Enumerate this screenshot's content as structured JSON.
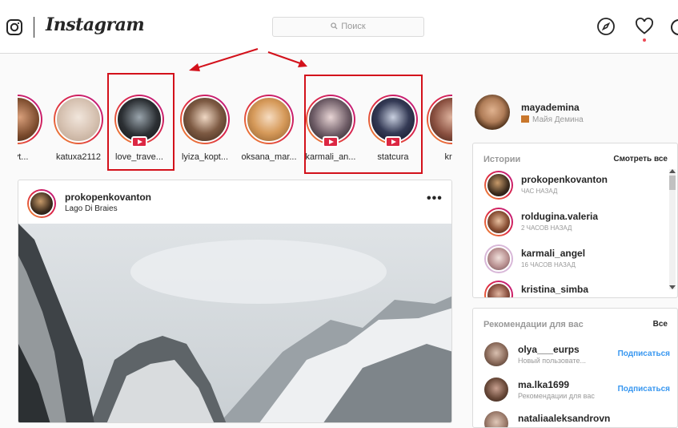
{
  "header": {
    "logo_text": "Instagram",
    "search_placeholder": "Поиск",
    "icons": [
      "instagram-camera-icon",
      "search-icon",
      "explore-compass-icon",
      "heart-icon",
      "profile-icon"
    ]
  },
  "stories": [
    {
      "username": "myt...",
      "live": false
    },
    {
      "username": "katuxa2112",
      "live": false
    },
    {
      "username": "love_trave...",
      "live": true,
      "highlighted": true
    },
    {
      "username": "lyiza_kopt...",
      "live": false
    },
    {
      "username": "oksana_mar...",
      "live": false
    },
    {
      "username": "karmali_an...",
      "live": true,
      "highlighted": true
    },
    {
      "username": "statcura",
      "live": true,
      "highlighted": true
    },
    {
      "username": "kris",
      "live": false
    }
  ],
  "post": {
    "username": "prokopenkovanton",
    "location": "Lago Di Braies",
    "more_label": "•••"
  },
  "sidebar": {
    "username": "mayademina",
    "full_name": "Майя Демина",
    "stories_card": {
      "title": "Истории",
      "see_all": "Смотреть все",
      "items": [
        {
          "username": "prokopenkovanton",
          "time": "ЧАС НАЗАД"
        },
        {
          "username": "roldugina.valeria",
          "time": "2 ЧАСОВ НАЗАД"
        },
        {
          "username": "karmali_angel",
          "time": "16 ЧАСОВ НАЗАД"
        },
        {
          "username": "kristina_simba",
          "time": ""
        }
      ]
    },
    "recommendations_card": {
      "title": "Рекомендации для вас",
      "see_all": "Все",
      "items": [
        {
          "username": "olya___eurps",
          "subtitle": "Новый пользовате...",
          "action": "Подписаться"
        },
        {
          "username": "ma.lka1699",
          "subtitle": "Рекомендации для вас",
          "action": "Подписаться"
        },
        {
          "username": "nataliaaleksandrovn",
          "subtitle": "",
          "action": ""
        }
      ]
    }
  },
  "colors": {
    "annotation_red": "#d3111b",
    "follow_blue": "#3897f0",
    "live_badge": "#dc2743"
  }
}
